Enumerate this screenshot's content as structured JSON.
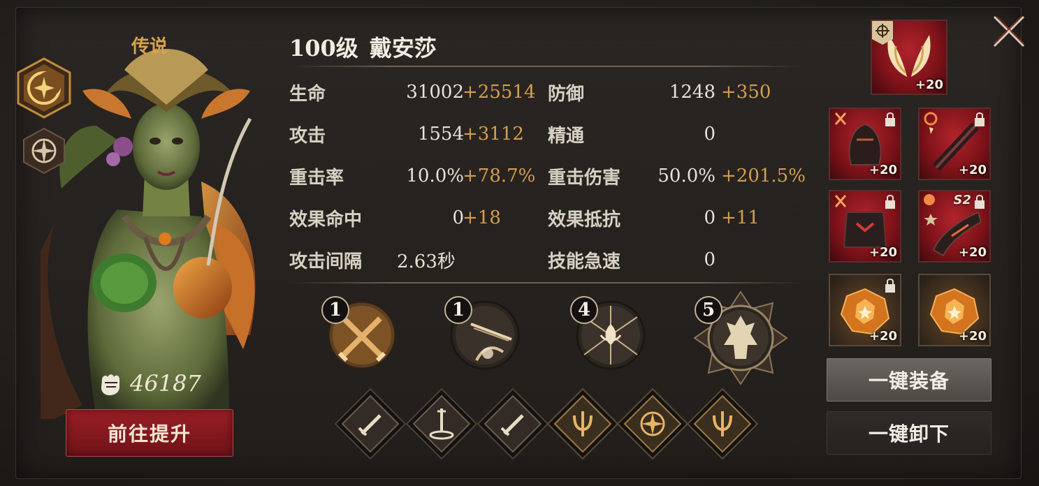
{
  "hero": {
    "rarity": "传说",
    "level": "100级",
    "name": "戴安莎",
    "power": "46187"
  },
  "actions": {
    "upgrade": "前往提升",
    "equip_all": "一键装备",
    "unequip_all": "一键卸下"
  },
  "stats": {
    "hp": {
      "label": "生命",
      "base": "31002",
      "bonus": "+25514"
    },
    "def": {
      "label": "防御",
      "base": "1248",
      "bonus": "+350"
    },
    "atk": {
      "label": "攻击",
      "base": "1554",
      "bonus": "+3112"
    },
    "mastery": {
      "label": "精通",
      "base": "0",
      "bonus": ""
    },
    "crit_rate": {
      "label": "重击率",
      "base": "10.0%",
      "bonus": "+78.7%"
    },
    "crit_dmg": {
      "label": "重击伤害",
      "base": "50.0%",
      "bonus": "+201.5%"
    },
    "effect_hit": {
      "label": "效果命中",
      "base": "0",
      "bonus": "+18"
    },
    "effect_res": {
      "label": "效果抵抗",
      "base": "0",
      "bonus": "+11"
    },
    "atk_interval": {
      "label": "攻击间隔",
      "base": "2.63秒",
      "bonus": ""
    },
    "skill_haste": {
      "label": "技能急速",
      "base": "0",
      "bonus": ""
    }
  },
  "skills": [
    {
      "level": "1",
      "icon": "crossed-swords-icon"
    },
    {
      "level": "1",
      "icon": "arrow-strike-icon"
    },
    {
      "level": "4",
      "icon": "lotus-burst-icon"
    },
    {
      "level": "5",
      "icon": "ultimate-figure-icon"
    }
  ],
  "talents": [
    {
      "icon": "sword-icon"
    },
    {
      "icon": "sword-altar-icon"
    },
    {
      "icon": "sword-icon"
    },
    {
      "icon": "trident-icon"
    },
    {
      "icon": "compass-star-icon"
    },
    {
      "icon": "trident-icon"
    }
  ],
  "equipment": {
    "wings": {
      "level": "+20",
      "badge": "compass-badge-icon"
    },
    "helmet": {
      "level": "+20"
    },
    "weapon": {
      "level": "+20"
    },
    "armor": {
      "level": "+20"
    },
    "gloves": {
      "level": "+20",
      "set": "S2"
    },
    "gem_1": {
      "level": "+20"
    },
    "gem_2": {
      "level": "+20"
    }
  },
  "colors": {
    "accent_gold": "#d49f4f",
    "upgrade_red": "#9a1f26"
  }
}
